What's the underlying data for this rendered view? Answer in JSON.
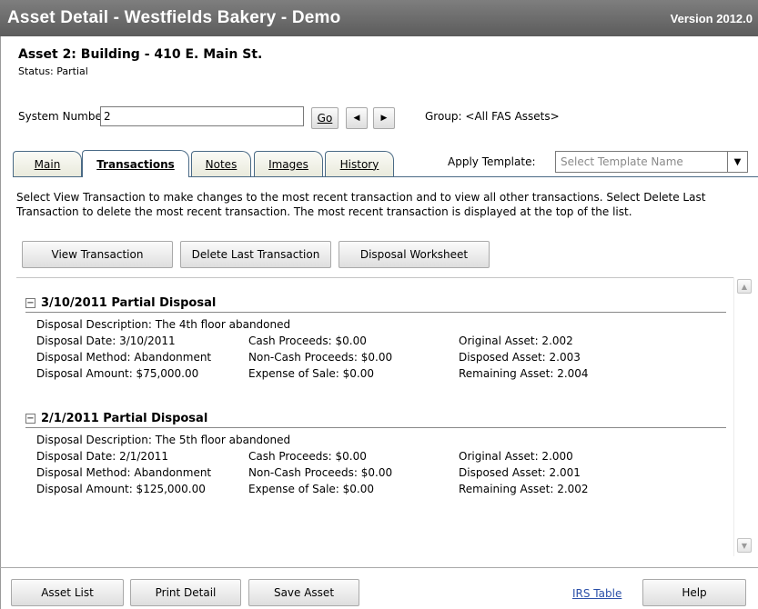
{
  "window": {
    "title": "Asset Detail - Westfields Bakery - Demo",
    "version": "Version 2012.0"
  },
  "asset": {
    "title": "Asset 2: Building - 410 E. Main St.",
    "status": "Status: Partial"
  },
  "system": {
    "label": "System Number:",
    "value": "2",
    "go_label": "Go",
    "prev_icon": "◀",
    "next_icon": "▶",
    "group": "Group: <All FAS Assets>"
  },
  "tabs": [
    {
      "label": "Main"
    },
    {
      "label": "Transactions"
    },
    {
      "label": "Notes"
    },
    {
      "label": "Images"
    },
    {
      "label": "History"
    }
  ],
  "template": {
    "label": "Apply Template:",
    "placeholder": "Select Template Name",
    "dropdown_icon": "▼"
  },
  "instructions": "Select View Transaction to make changes to the most recent transaction and to view all other transactions. Select Delete Last Transaction to delete the most recent transaction. The most recent transaction is displayed at the top of the list.",
  "actions": {
    "view": "View Transaction",
    "delete": "Delete Last Transaction",
    "worksheet": "Disposal Worksheet"
  },
  "transactions": [
    {
      "heading": "3/10/2011 Partial Disposal",
      "description": "Disposal Description: The 4th floor abandoned",
      "date": "Disposal Date: 3/10/2011",
      "method": "Disposal Method: Abandonment",
      "amount": "Disposal Amount: $75,000.00",
      "cash": "Cash Proceeds: $0.00",
      "noncash": "Non-Cash Proceeds: $0.00",
      "expense": "Expense of Sale: $0.00",
      "original": "Original Asset: 2.002",
      "disposed": "Disposed Asset: 2.003",
      "remaining": "Remaining Asset: 2.004"
    },
    {
      "heading": "2/1/2011 Partial Disposal",
      "description": "Disposal Description: The 5th floor abandoned",
      "date": "Disposal Date: 2/1/2011",
      "method": "Disposal Method: Abandonment",
      "amount": "Disposal Amount: $125,000.00",
      "cash": "Cash Proceeds: $0.00",
      "noncash": "Non-Cash Proceeds: $0.00",
      "expense": "Expense of Sale: $0.00",
      "original": "Original Asset: 2.000",
      "disposed": "Disposed Asset: 2.001",
      "remaining": "Remaining Asset: 2.002"
    }
  ],
  "footer": {
    "asset_list": "Asset List",
    "print_detail": "Print Detail",
    "save_asset": "Save Asset",
    "irs_table": "IRS Table",
    "help": "Help"
  }
}
